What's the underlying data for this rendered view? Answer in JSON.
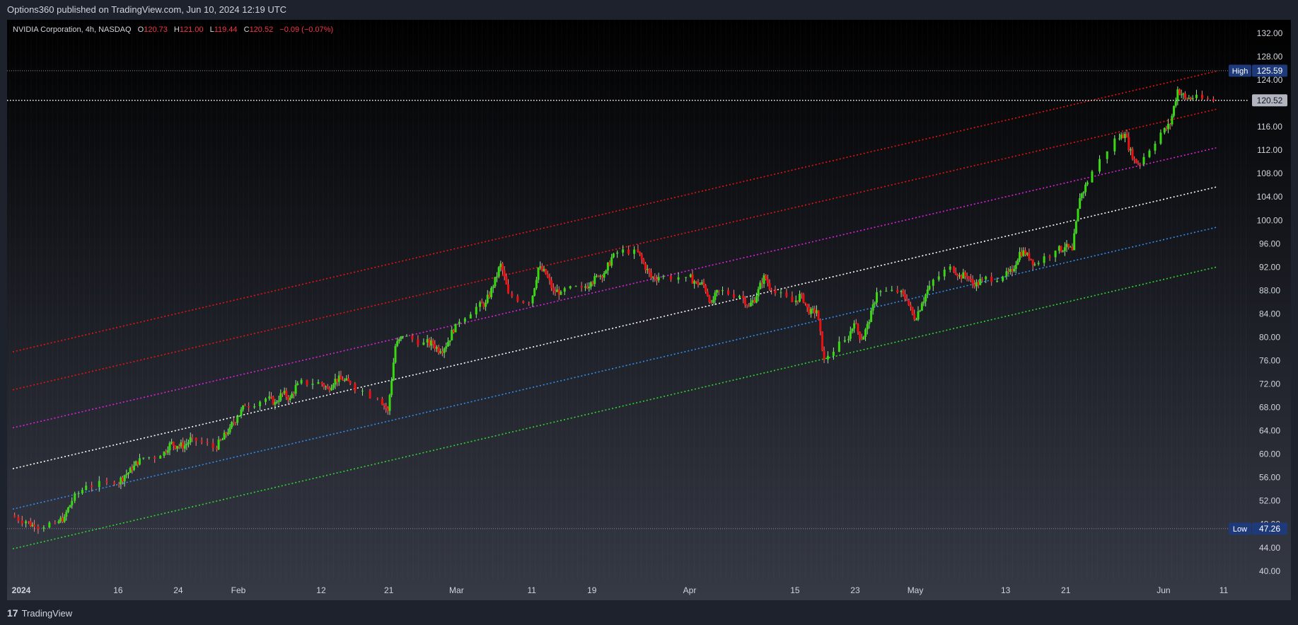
{
  "header": {
    "published": "Options360 published on TradingView.com, Jun 10, 2024 12:19 UTC"
  },
  "footer": {
    "brand": "TradingView"
  },
  "colors": {
    "up": "#38d910",
    "down": "#ee1010",
    "axis_text": "#d1d4dc"
  },
  "chart_data": {
    "type": "candlestick",
    "symbol": "NVIDIA Corporation",
    "interval": "4h",
    "exchange": "NASDAQ",
    "ohlc": {
      "o_label": "O",
      "o": "120.73",
      "h_label": "H",
      "h": "121.00",
      "l_label": "L",
      "l": "119.44",
      "c_label": "C",
      "c": "120.52",
      "change": "−0.09 (−0.07%)"
    },
    "ylim": [
      38.4,
      134.3
    ],
    "y_ticks": [
      "40.00",
      "44.00",
      "48.00",
      "52.00",
      "56.00",
      "60.00",
      "64.00",
      "68.00",
      "72.00",
      "76.00",
      "80.00",
      "84.00",
      "88.00",
      "92.00",
      "96.00",
      "100.00",
      "104.00",
      "108.00",
      "112.00",
      "116.00",
      "120.00",
      "124.00",
      "128.00",
      "132.00"
    ],
    "x_ticks": [
      {
        "label": "2024",
        "date": "2024-01-02"
      },
      {
        "label": "16",
        "date": "2024-01-16"
      },
      {
        "label": "24",
        "date": "2024-01-24"
      },
      {
        "label": "Feb",
        "date": "2024-02-01"
      },
      {
        "label": "12",
        "date": "2024-02-12"
      },
      {
        "label": "21",
        "date": "2024-02-21"
      },
      {
        "label": "Mar",
        "date": "2024-03-01"
      },
      {
        "label": "11",
        "date": "2024-03-11"
      },
      {
        "label": "19",
        "date": "2024-03-19"
      },
      {
        "label": "Apr",
        "date": "2024-04-01"
      },
      {
        "label": "15",
        "date": "2024-04-15"
      },
      {
        "label": "23",
        "date": "2024-04-23"
      },
      {
        "label": "May",
        "date": "2024-05-01"
      },
      {
        "label": "13",
        "date": "2024-05-13"
      },
      {
        "label": "21",
        "date": "2024-05-21"
      },
      {
        "label": "Jun",
        "date": "2024-06-03"
      },
      {
        "label": "11",
        "date": "2024-06-11"
      }
    ],
    "high": {
      "label": "High",
      "value": "125.59"
    },
    "low": {
      "label": "Low",
      "value": "47.26"
    },
    "last_price": "120.52",
    "channel": {
      "start": "2024-01-02",
      "end": "2024-06-10",
      "levels": [
        {
          "color": "#ee1111",
          "start_value": 77.5,
          "end_value": 125.5
        },
        {
          "color": "#ee1111",
          "start_value": 71.0,
          "end_value": 119.0
        },
        {
          "color": "#e020e0",
          "start_value": 64.5,
          "end_value": 112.4
        },
        {
          "color": "#ffffff",
          "start_value": 57.5,
          "end_value": 105.7
        },
        {
          "color": "#2f8ff0",
          "start_value": 50.6,
          "end_value": 98.8
        },
        {
          "color": "#2ed82e",
          "start_value": 43.8,
          "end_value": 92.0
        }
      ]
    },
    "price_path": [
      [
        "2024-01-02",
        49.5
      ],
      [
        "2024-01-04",
        48.5
      ],
      [
        "2024-01-05",
        47.6
      ],
      [
        "2024-01-08",
        48.2
      ],
      [
        "2024-01-09",
        49.3
      ],
      [
        "2024-01-10",
        52.0
      ],
      [
        "2024-01-12",
        54.6
      ],
      [
        "2024-01-16",
        54.9
      ],
      [
        "2024-01-17",
        56.4
      ],
      [
        "2024-01-18",
        57.3
      ],
      [
        "2024-01-19",
        59.3
      ],
      [
        "2024-01-22",
        59.7
      ],
      [
        "2024-01-23",
        61.9
      ],
      [
        "2024-01-24",
        61.4
      ],
      [
        "2024-01-25",
        61.5
      ],
      [
        "2024-01-26",
        62.8
      ],
      [
        "2024-01-29",
        61.1
      ],
      [
        "2024-01-30",
        62.5
      ],
      [
        "2024-01-31",
        64.6
      ],
      [
        "2024-02-01",
        66.4
      ],
      [
        "2024-02-02",
        68.2
      ],
      [
        "2024-02-05",
        69.5
      ],
      [
        "2024-02-06",
        68.9
      ],
      [
        "2024-02-07",
        70.4
      ],
      [
        "2024-02-08",
        69.6
      ],
      [
        "2024-02-09",
        72.1
      ],
      [
        "2024-02-12",
        72.3
      ],
      [
        "2024-02-13",
        71.2
      ],
      [
        "2024-02-14",
        72.9
      ],
      [
        "2024-02-15",
        72.6
      ],
      [
        "2024-02-16",
        72.1
      ],
      [
        "2024-02-20",
        69.5
      ],
      [
        "2024-02-21",
        67.4
      ],
      [
        "2024-02-22",
        78.5
      ],
      [
        "2024-02-23",
        80.2
      ],
      [
        "2024-02-26",
        79.1
      ],
      [
        "2024-02-27",
        78.8
      ],
      [
        "2024-02-28",
        77.6
      ],
      [
        "2024-02-29",
        79.2
      ],
      [
        "2024-03-01",
        82.3
      ],
      [
        "2024-03-04",
        85.2
      ],
      [
        "2024-03-05",
        85.9
      ],
      [
        "2024-03-06",
        88.7
      ],
      [
        "2024-03-07",
        92.6
      ],
      [
        "2024-03-08",
        87.5
      ],
      [
        "2024-03-11",
        85.8
      ],
      [
        "2024-03-12",
        91.9
      ],
      [
        "2024-03-13",
        90.8
      ],
      [
        "2024-03-14",
        87.9
      ],
      [
        "2024-03-15",
        87.8
      ],
      [
        "2024-03-18",
        88.5
      ],
      [
        "2024-03-19",
        89.4
      ],
      [
        "2024-03-20",
        90.4
      ],
      [
        "2024-03-21",
        91.4
      ],
      [
        "2024-03-22",
        94.3
      ],
      [
        "2024-03-25",
        95.0
      ],
      [
        "2024-03-26",
        92.6
      ],
      [
        "2024-03-27",
        90.2
      ],
      [
        "2024-03-28",
        90.3
      ],
      [
        "2024-04-01",
        90.3
      ],
      [
        "2024-04-02",
        89.4
      ],
      [
        "2024-04-03",
        88.9
      ],
      [
        "2024-04-04",
        85.9
      ],
      [
        "2024-04-05",
        88.0
      ],
      [
        "2024-04-08",
        87.1
      ],
      [
        "2024-04-09",
        85.3
      ],
      [
        "2024-04-10",
        87.0
      ],
      [
        "2024-04-11",
        90.6
      ],
      [
        "2024-04-12",
        88.1
      ],
      [
        "2024-04-15",
        86.0
      ],
      [
        "2024-04-16",
        87.4
      ],
      [
        "2024-04-17",
        84.0
      ],
      [
        "2024-04-18",
        84.6
      ],
      [
        "2024-04-19",
        76.2
      ],
      [
        "2024-04-22",
        79.5
      ],
      [
        "2024-04-23",
        82.4
      ],
      [
        "2024-04-24",
        79.6
      ],
      [
        "2024-04-25",
        82.6
      ],
      [
        "2024-04-26",
        87.7
      ],
      [
        "2024-04-29",
        87.7
      ],
      [
        "2024-04-30",
        86.4
      ],
      [
        "2024-05-01",
        83.0
      ],
      [
        "2024-05-02",
        85.8
      ],
      [
        "2024-05-03",
        88.8
      ],
      [
        "2024-05-06",
        92.1
      ],
      [
        "2024-05-07",
        90.6
      ],
      [
        "2024-05-08",
        90.4
      ],
      [
        "2024-05-09",
        88.7
      ],
      [
        "2024-05-10",
        89.9
      ],
      [
        "2024-05-13",
        90.4
      ],
      [
        "2024-05-14",
        91.3
      ],
      [
        "2024-05-15",
        94.6
      ],
      [
        "2024-05-16",
        94.4
      ],
      [
        "2024-05-17",
        92.5
      ],
      [
        "2024-05-20",
        94.8
      ],
      [
        "2024-05-21",
        95.4
      ],
      [
        "2024-05-22",
        94.9
      ],
      [
        "2024-05-23",
        103.8
      ],
      [
        "2024-05-24",
        106.5
      ],
      [
        "2024-05-28",
        114.0
      ],
      [
        "2024-05-29",
        114.8
      ],
      [
        "2024-05-30",
        110.5
      ],
      [
        "2024-05-31",
        109.6
      ],
      [
        "2024-06-03",
        115.0
      ],
      [
        "2024-06-04",
        116.4
      ],
      [
        "2024-06-05",
        122.4
      ],
      [
        "2024-06-06",
        120.9
      ],
      [
        "2024-06-07",
        120.9
      ],
      [
        "2024-06-10",
        120.5
      ]
    ]
  }
}
